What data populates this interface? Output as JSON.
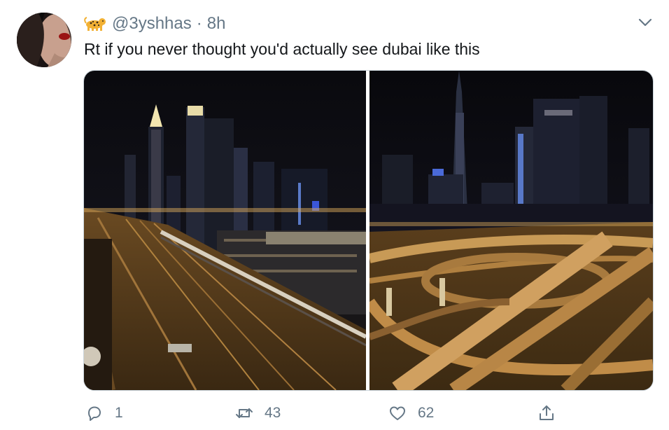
{
  "tweet": {
    "handle": "@3yshhas",
    "separator": "·",
    "time": "8h",
    "text": "Rt if you never thought you'd actually see dubai like this"
  },
  "icons": {
    "avatar": "avatar-photo",
    "emoji": "leopard-emoji",
    "menu": "chevron-down-icon",
    "reply": "reply-icon",
    "retweet": "retweet-icon",
    "like": "heart-icon",
    "share": "share-icon"
  },
  "media": [
    {
      "description": "empty highway night city"
    },
    {
      "description": "empty interchange night city"
    }
  ],
  "actions": {
    "replies": "1",
    "retweets": "43",
    "likes": "62",
    "share": ""
  },
  "colors": {
    "text": "#14171a",
    "secondary": "#657786",
    "border": "#ccd6dd"
  }
}
